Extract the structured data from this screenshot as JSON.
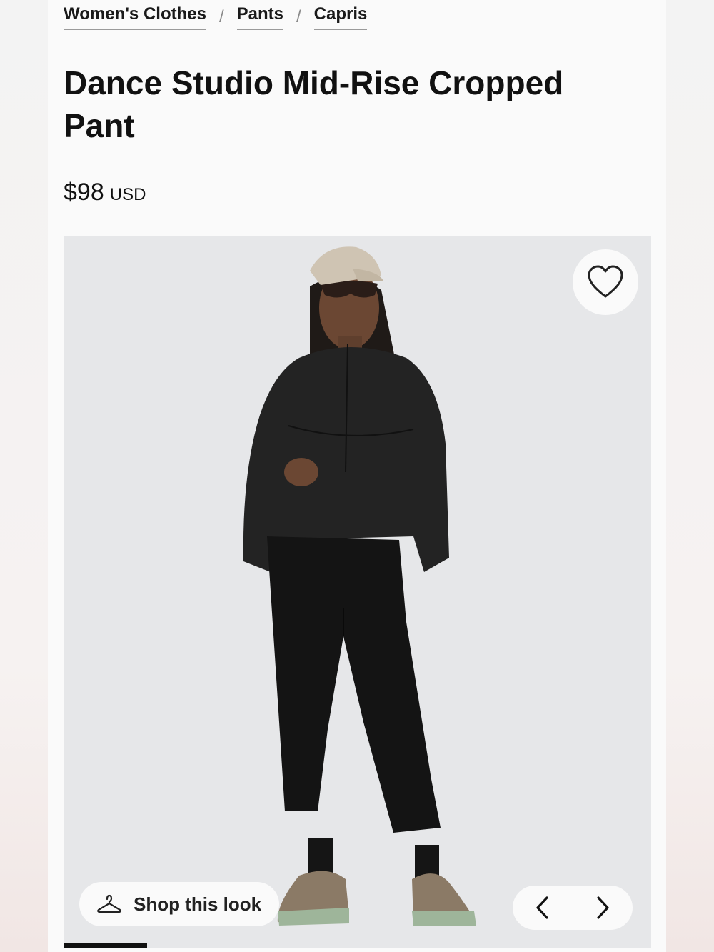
{
  "breadcrumb": {
    "items": [
      {
        "label": "Women's Clothes"
      },
      {
        "label": "Pants"
      },
      {
        "label": "Capris"
      }
    ],
    "separator": "/"
  },
  "product": {
    "title": "Dance Studio Mid-Rise Cropped Pant",
    "price": "$98",
    "currency": "USD"
  },
  "gallery": {
    "shop_look_label": "Shop this look",
    "icons": {
      "wishlist": "heart-icon",
      "shop_look": "hanger-icon",
      "prev": "chevron-left-icon",
      "next": "chevron-right-icon"
    }
  },
  "colors": {
    "text": "#111111",
    "image_bg": "#e6e7e9",
    "control_bg": "#fafafa"
  }
}
